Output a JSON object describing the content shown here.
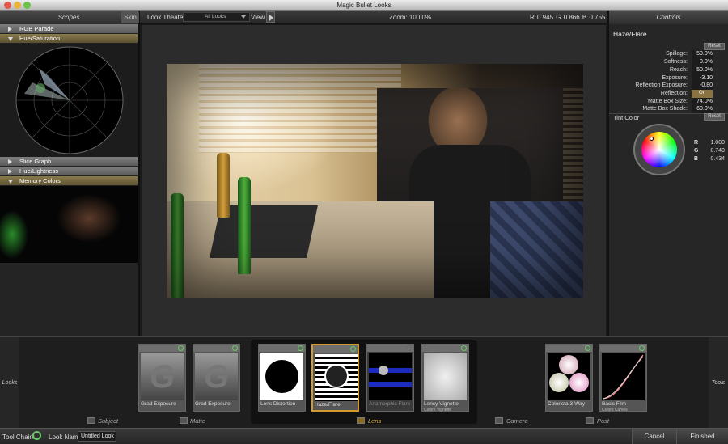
{
  "app": {
    "title": "Magic Bullet Looks"
  },
  "scopes": {
    "header": "Scopes",
    "sections": [
      {
        "label": "RGB Parade",
        "open": false
      },
      {
        "label": "Hue/Saturation",
        "open": true
      },
      {
        "label": "Slice Graph",
        "open": false
      },
      {
        "label": "Hue/Lightness",
        "open": false
      },
      {
        "label": "Memory Colors",
        "open": true
      }
    ]
  },
  "toolbar": {
    "skin": "Skin",
    "look_theater": "Look Theater",
    "dropdown_value": "All Looks",
    "view": "View",
    "zoom": "Zoom:  100.0%",
    "rgb": "R 0.945   G 0.866   B 0.755"
  },
  "controls": {
    "header": "Controls",
    "tool_name": "Haze/Flare",
    "reset": "Reset",
    "params": [
      {
        "label": "Spillage:",
        "value": "50.0%"
      },
      {
        "label": "Softness:",
        "value": "0.0%"
      },
      {
        "label": "Reach:",
        "value": "50.0%"
      },
      {
        "label": "Exposure:",
        "value": "-3.10"
      },
      {
        "label": "Reflection Exposure:",
        "value": "-0.80"
      },
      {
        "label": "Reflection:",
        "value": "On"
      },
      {
        "label": "Matte Box Size:",
        "value": "74.0%"
      },
      {
        "label": "Matte Box Shade:",
        "value": "60.0%"
      }
    ],
    "tint": {
      "label": "Tint Color",
      "reset": "Reset",
      "r_label": "R",
      "r": "1.000",
      "g_label": "G",
      "g": "0.749",
      "b_label": "B",
      "b": "0.434"
    }
  },
  "bottom": {
    "looks": "Looks",
    "tools": "Tools",
    "cards": [
      {
        "label": "Grad Exposure",
        "sub": ""
      },
      {
        "label": "Grad Exposure",
        "sub": ""
      },
      {
        "label": "Lens Distortion",
        "sub": ""
      },
      {
        "label": "Haze/Flare",
        "sub": ""
      },
      {
        "label": "Anamorphic Flare",
        "sub": ""
      },
      {
        "label": "Lensy Vignette",
        "sub": "Colors Vignette"
      },
      {
        "label": "Colorista 3-Way",
        "sub": ""
      },
      {
        "label": "Basic Film",
        "sub": "Colors Curves"
      }
    ],
    "groups": [
      "Subject",
      "Matte",
      "Lens",
      "Camera",
      "Post"
    ]
  },
  "status": {
    "tool_chain": "Tool Chain:",
    "look_name_label": "Look Name:",
    "look_name": "Untitled Look",
    "cancel": "Cancel",
    "finished": "Finished"
  }
}
